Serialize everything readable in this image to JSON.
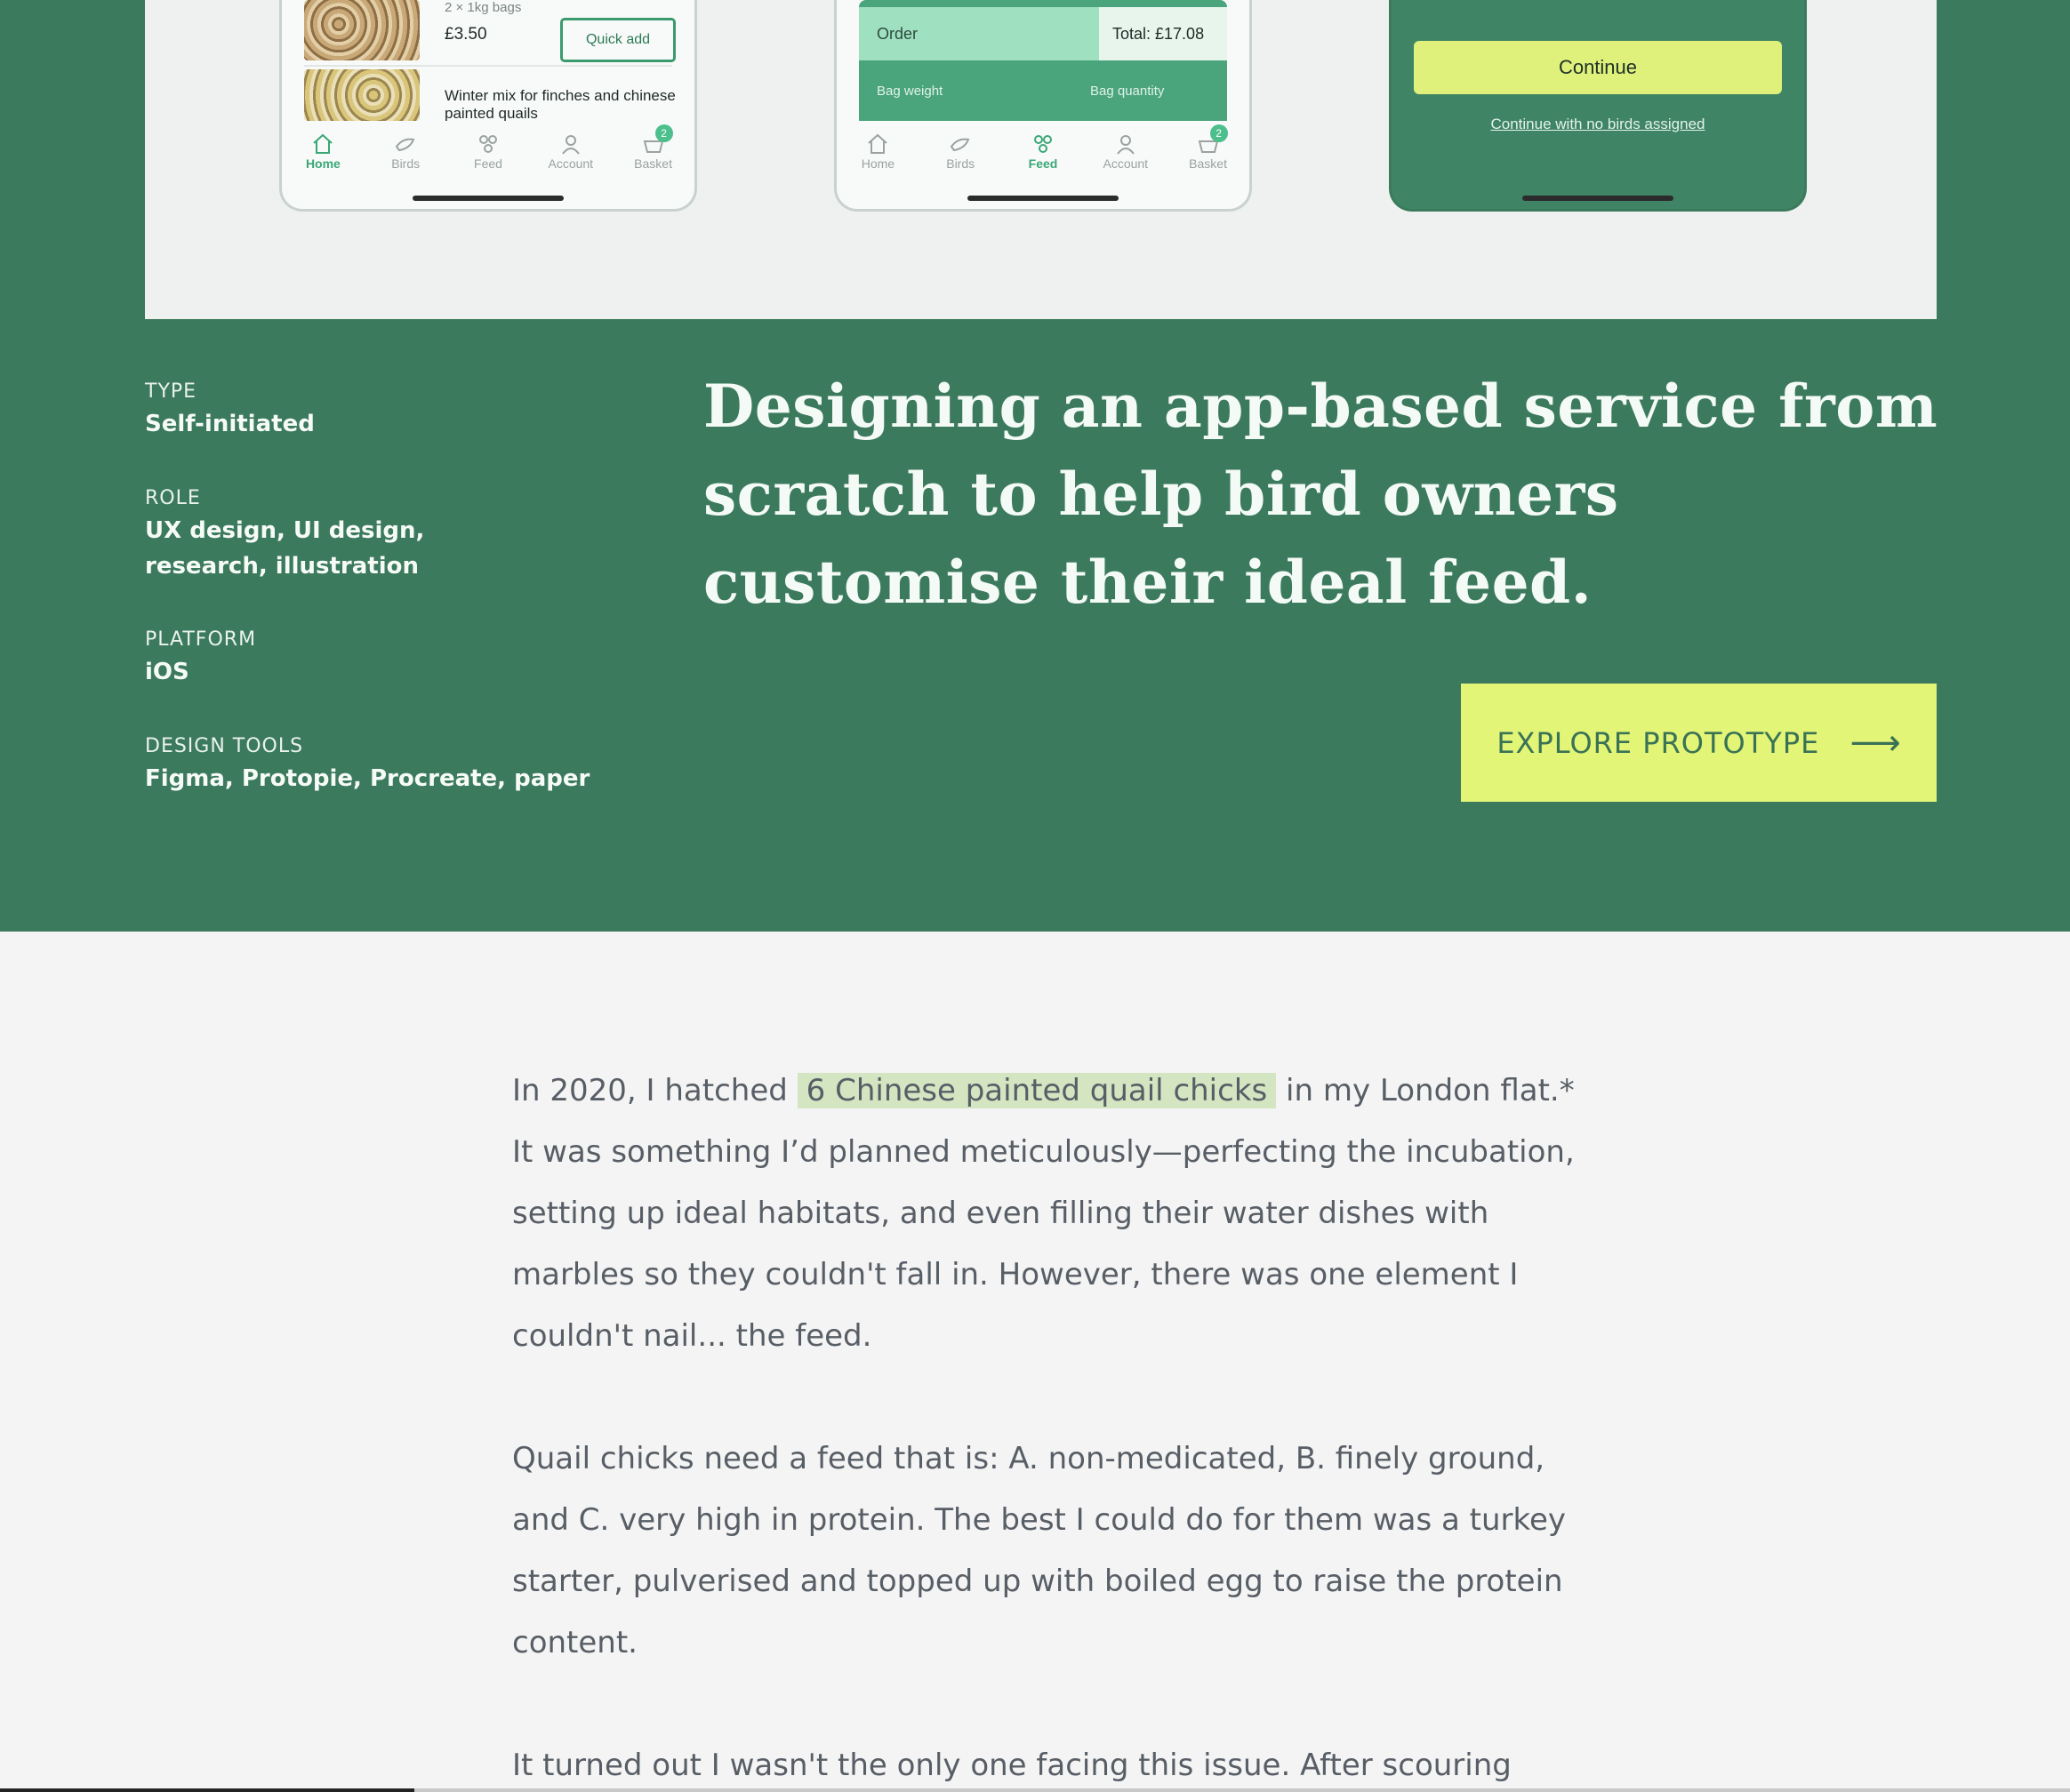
{
  "mockups": {
    "phone1": {
      "bag_size": "2 × 1kg bags",
      "price": "£3.50",
      "quick_add": "Quick add",
      "item_title": "Winter mix for finches and chinese painted quails",
      "tabs": [
        {
          "label": "Home",
          "icon": "home-icon",
          "active": true
        },
        {
          "label": "Birds",
          "icon": "bird-icon",
          "active": false
        },
        {
          "label": "Feed",
          "icon": "feed-icon",
          "active": false
        },
        {
          "label": "Account",
          "icon": "account-icon",
          "active": false
        },
        {
          "label": "Basket",
          "icon": "basket-icon",
          "active": false,
          "badge": "2"
        }
      ]
    },
    "phone2": {
      "order_label": "Order",
      "total": "Total: £17.08",
      "bag_weight": "Bag weight",
      "bag_quantity": "Bag quantity",
      "tabs": [
        {
          "label": "Home",
          "icon": "home-icon",
          "active": false
        },
        {
          "label": "Birds",
          "icon": "bird-icon",
          "active": false
        },
        {
          "label": "Feed",
          "icon": "feed-icon",
          "active": true
        },
        {
          "label": "Account",
          "icon": "account-icon",
          "active": false
        },
        {
          "label": "Basket",
          "icon": "basket-icon",
          "active": false,
          "badge": "2"
        }
      ]
    },
    "phone3": {
      "continue_label": "Continue",
      "link_label": "Continue with no birds assigned"
    }
  },
  "meta": {
    "type_label": "TYPE",
    "type_value": "Self-initiated",
    "role_label": "ROLE",
    "role_value": "UX design, UI design, research, illustration",
    "platform_label": "PLATFORM",
    "platform_value": "iOS",
    "tools_label": "DESIGN TOOLS",
    "tools_value": "Figma, Protopie, Procreate, paper"
  },
  "headline": "Designing an app-based service from scratch to help bird owners customise their ideal feed.",
  "cta": {
    "label": "EXPLORE PROTOTYPE",
    "icon": "arrow-right-icon"
  },
  "article": {
    "p1_before": "In 2020, I hatched ",
    "p1_highlight": "6 Chinese painted quail chicks",
    "p1_after": " in my London flat.* It was something I’d planned meticulously—perfecting the incubation, setting up ideal habitats, and even filling their water dishes with marbles so they couldn't fall in. However, there was one element I couldn't nail... the feed.",
    "p2": "Quail chicks need a feed that is: A. non-medicated, B. finely ground, and C. very high in protein. The best I could do for them was a turkey starter, pulverised and topped up with boiled egg to raise the protein content.",
    "p3": "It turned out I wasn't the only one facing this issue. After scouring"
  },
  "colors": {
    "brand_green": "#3c7a5d",
    "accent_lime": "#e2f576",
    "highlight": "#d4e5c2",
    "body_text": "#585e66"
  }
}
